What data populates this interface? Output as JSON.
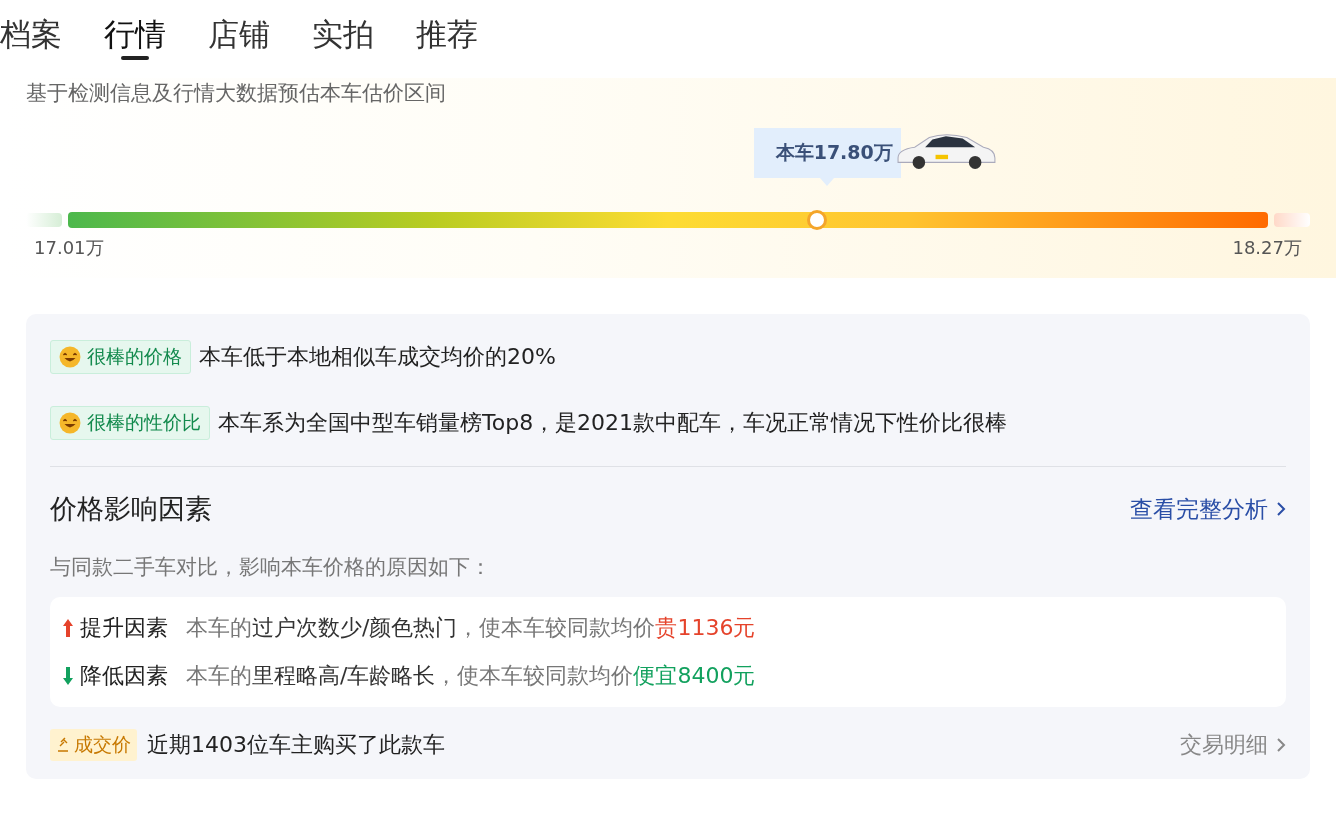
{
  "tabs": [
    {
      "label": "档案",
      "selected": false
    },
    {
      "label": "行情",
      "selected": true
    },
    {
      "label": "店铺",
      "selected": false
    },
    {
      "label": "实拍",
      "selected": false
    },
    {
      "label": "推荐",
      "selected": false
    }
  ],
  "estimate": {
    "subtitle": "基于检测信息及行情大数据预估本车估价区间",
    "price_label": "本车17.80万",
    "level": 0.624,
    "min": "17.01万",
    "max": "18.27万"
  },
  "highlights": [
    {
      "tag": "很棒的价格",
      "text": "本车低于本地相似车成交均价的20%"
    },
    {
      "tag": "很棒的性价比",
      "text": "本车系为全国中型车销量榜Top8，是2021款中配车，车况正常情况下性价比很棒"
    }
  ],
  "factors": {
    "title": "价格影响因素",
    "link": "查看完整分析",
    "intro": "与同款二手车对比，影响本车价格的原因如下：",
    "items": [
      {
        "kind": "up",
        "label": "提升因素",
        "prefix": "本车的",
        "highlight": "过户次数少/颜色热门",
        "middle": "，使本车较同款均价",
        "effect": "贵1136元"
      },
      {
        "kind": "down",
        "label": "降低因素",
        "prefix": "本车的",
        "highlight": "里程略高/车龄略长",
        "middle": "，使本车较同款均价",
        "effect": "便宜8400元"
      }
    ]
  },
  "deal": {
    "tag": "成交价",
    "text": "近期1403位车主购买了此款车",
    "link": "交易明细"
  }
}
